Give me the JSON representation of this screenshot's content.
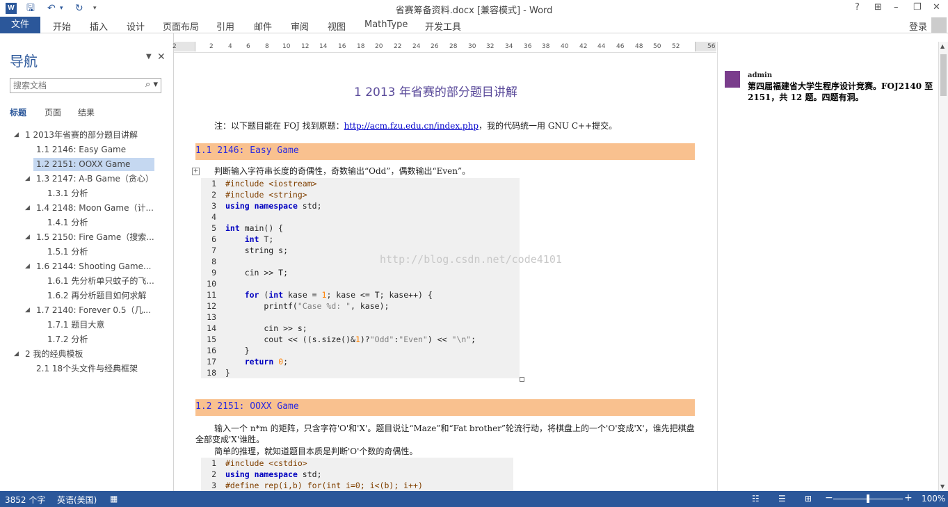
{
  "window": {
    "title": "省赛筹备资料.docx [兼容模式] - Word",
    "app_icon": "W",
    "help": "?",
    "controls": [
      "help-icon",
      "ribbon-display-icon",
      "minimize-icon",
      "restore-icon",
      "close-icon"
    ]
  },
  "ribbon": {
    "file": "文件",
    "tabs": [
      "开始",
      "插入",
      "设计",
      "页面布局",
      "引用",
      "邮件",
      "审阅",
      "视图",
      "MathType",
      "开发工具"
    ],
    "login": "登录"
  },
  "nav": {
    "title": "导航",
    "search_placeholder": "搜索文档",
    "tabs": [
      "标题",
      "页面",
      "结果"
    ],
    "tree": [
      {
        "label": "1 2013年省赛的部分题目讲解",
        "level": 1,
        "expander": "◢"
      },
      {
        "label": "1.1 2146: Easy Game",
        "level": 2,
        "expander": ""
      },
      {
        "label": "1.2 2151: OOXX Game",
        "level": 2,
        "expander": "",
        "selected": true
      },
      {
        "label": "1.3 2147: A-B Game（贪心）",
        "level": 2,
        "expander": "◢"
      },
      {
        "label": "1.3.1 分析",
        "level": 3,
        "expander": ""
      },
      {
        "label": "1.4 2148: Moon Game（计...",
        "level": 2,
        "expander": "◢"
      },
      {
        "label": "1.4.1 分析",
        "level": 3,
        "expander": ""
      },
      {
        "label": "1.5 2150: Fire Game（搜索...",
        "level": 2,
        "expander": "◢"
      },
      {
        "label": "1.5.1 分析",
        "level": 3,
        "expander": ""
      },
      {
        "label": "1.6 2144: Shooting Game...",
        "level": 2,
        "expander": "◢"
      },
      {
        "label": "1.6.1 先分析单只蚊子的飞...",
        "level": 3,
        "expander": ""
      },
      {
        "label": "1.6.2 再分析题目如何求解",
        "level": 3,
        "expander": ""
      },
      {
        "label": "1.7 2140: Forever 0.5（几...",
        "level": 2,
        "expander": "◢"
      },
      {
        "label": "1.7.1 题目大意",
        "level": 3,
        "expander": ""
      },
      {
        "label": "1.7.2 分析",
        "level": 3,
        "expander": ""
      },
      {
        "label": "2 我的经典模板",
        "level": 1,
        "expander": "◢"
      },
      {
        "label": "2.1 18个头文件与经典框架",
        "level": 2,
        "expander": ""
      }
    ]
  },
  "ruler": {
    "ticks": [
      "2",
      "2",
      "4",
      "6",
      "8",
      "10",
      "12",
      "14",
      "16",
      "18",
      "20",
      "22",
      "24",
      "26",
      "28",
      "30",
      "32",
      "34",
      "36",
      "38",
      "40",
      "42",
      "44",
      "46",
      "48",
      "50",
      "52",
      "56"
    ]
  },
  "document": {
    "heading1": "1   2013 年省赛的部分题目讲解",
    "note_prefix": "注：以下题目能在 FOJ 找到原题：",
    "note_link": "http://acm.fzu.edu.cn/index.php",
    "note_suffix": "，我的代码统一用 GNU C++提交。",
    "h2_1": "1.1  2146: Easy Game",
    "p_1": "判断输入字符串长度的奇偶性，奇数输出“Odd”，偶数输出“Even”。",
    "code_1": [
      {
        "n": "1",
        "t": "#include <iostream>"
      },
      {
        "n": "2",
        "t": "#include <string>"
      },
      {
        "n": "3",
        "t": "using namespace std;"
      },
      {
        "n": "4",
        "t": ""
      },
      {
        "n": "5",
        "t": "int main() {"
      },
      {
        "n": "6",
        "t": "    int T;"
      },
      {
        "n": "7",
        "t": "    string s;"
      },
      {
        "n": "8",
        "t": ""
      },
      {
        "n": "9",
        "t": "    cin >> T;"
      },
      {
        "n": "10",
        "t": ""
      },
      {
        "n": "11",
        "t": "    for (int kase = 1; kase <= T; kase++) {"
      },
      {
        "n": "12",
        "t": "        printf(\"Case %d: \", kase);"
      },
      {
        "n": "13",
        "t": ""
      },
      {
        "n": "14",
        "t": "        cin >> s;"
      },
      {
        "n": "15",
        "t": "        cout << ((s.size()&1)?\"Odd\":\"Even\") << \"\\n\";"
      },
      {
        "n": "16",
        "t": "    }"
      },
      {
        "n": "17",
        "t": "    return 0;"
      },
      {
        "n": "18",
        "t": "}"
      }
    ],
    "watermark": "http://blog.csdn.net/code4101",
    "h2_2": "1.2  2151: OOXX Game",
    "p_2a": "输入一个 n*m 的矩阵，只含字符'O'和'X'。题目说让“Maze”和“Fat brother”轮流行动，将棋盘上的一个'O'变成'X'，谁先把棋盘全部变成'X'谁胜。",
    "p_2b": "简单的推理，就知道题目本质是判断'O'个数的奇偶性。",
    "code_2": [
      {
        "n": "1",
        "t": "#include <cstdio>"
      },
      {
        "n": "2",
        "t": "using namespace std;"
      },
      {
        "n": "3",
        "t": "#define rep(i,b) for(int i=0; i<(b); i++)"
      }
    ]
  },
  "comment": {
    "author": "admin",
    "text": "第四届福建省大学生程序设计竞赛。FOJ2140 至 2151，共 12 题。四题有洞。"
  },
  "status": {
    "word_count": "3852 个字",
    "language": "英语(美国)",
    "zoom": "100%",
    "zoom_level": 1.0,
    "zoom_minus": "−",
    "zoom_plus": "+"
  }
}
